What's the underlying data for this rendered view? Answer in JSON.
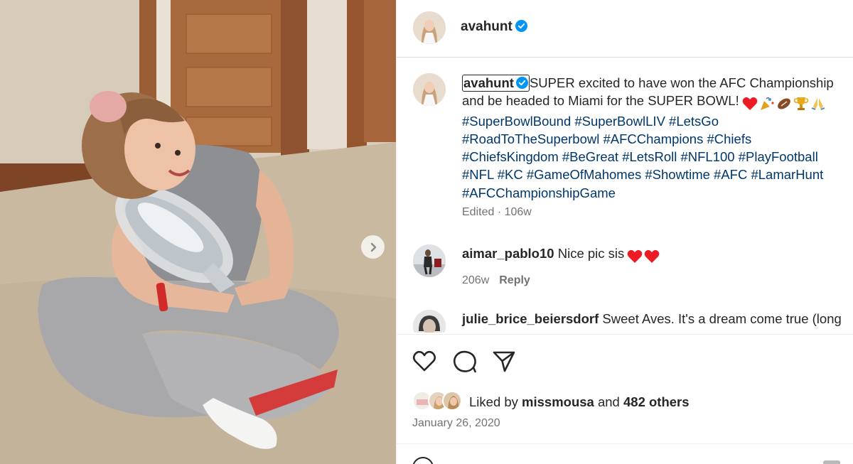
{
  "post": {
    "username": "avahunt",
    "verified": true
  },
  "caption": {
    "username": "avahunt",
    "text": "SUPER excited to have won the AFC Championship and be headed to Miami for the SUPER BOWL!",
    "emojis": [
      "red-heart",
      "party-popper",
      "american-football",
      "trophy",
      "folded-hands"
    ],
    "hashtags": "#SuperBowlBound #SuperBowlLIV #LetsGo #RoadToTheSuperbowl #AFCChampions #Chiefs #ChiefsKingdom #BeGreat #LetsRoll #NFL100 #PlayFootball #NFL #KC #GameOfMahomes #Showtime #AFC #LamarHunt #AFCChampionshipGame",
    "meta": "Edited · 106w"
  },
  "comments": [
    {
      "username": "aimar_pablo10",
      "text": "Nice pic sis",
      "emojis": [
        "red-heart",
        "red-heart"
      ],
      "time": "206w",
      "reply": "Reply"
    },
    {
      "username": "julie_brice_beiersdorf",
      "text": "Sweet Aves. It's a dream come true (long"
    }
  ],
  "likes": {
    "prefix": "Liked by",
    "user": "missmousa",
    "middle": "and",
    "others": "482 others"
  },
  "date": "January 26, 2020",
  "colors": {
    "text": "#262626",
    "secondary": "#737373",
    "hashtag": "#00376b",
    "verified": "#0095f6",
    "heart": "#ed1c24"
  }
}
